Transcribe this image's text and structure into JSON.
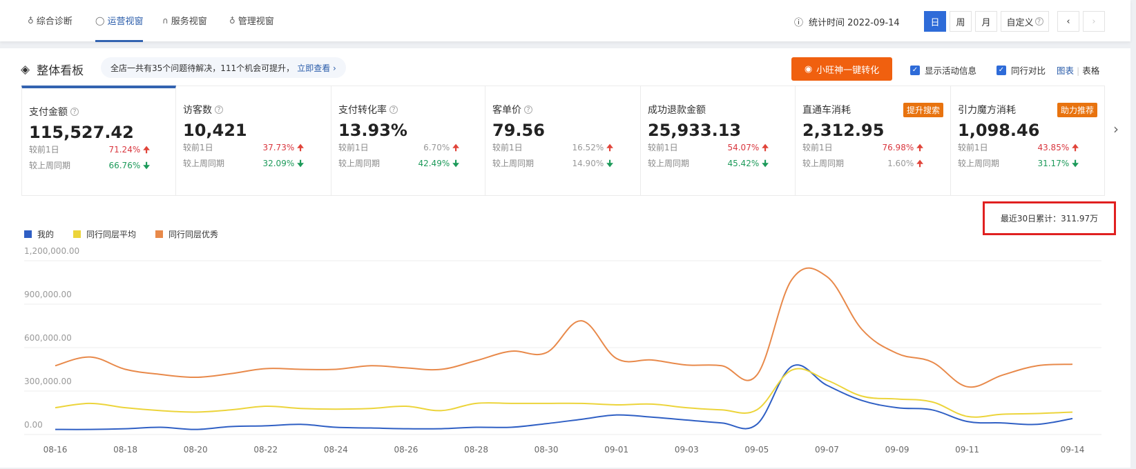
{
  "nav": {
    "tabs": [
      {
        "label": "综合诊断",
        "icon": "bulb-icon"
      },
      {
        "label": "运营视窗",
        "icon": "shield-icon",
        "active": true
      },
      {
        "label": "服务视窗",
        "icon": "headset-icon"
      },
      {
        "label": "管理视窗",
        "icon": "medal-icon"
      }
    ],
    "stat_label": "统计时间 2022-09-14",
    "periods": [
      "日",
      "周",
      "月",
      "自定义"
    ],
    "active_period": "日"
  },
  "board": {
    "title": "整体看板",
    "notice": "全店一共有35个问题待解决，111个机会可提升，",
    "notice_link": "立即查看 ›",
    "convert_button": "小旺神一键转化",
    "show_activity": "显示活动信息",
    "peer_compare": "同行对比",
    "view_chart": "图表",
    "view_table": "表格"
  },
  "cards": [
    {
      "title": "支付金额",
      "value": "115,527.42",
      "d1": "71.24%",
      "d1dir": "up",
      "w1": "66.76%",
      "w1dir": "down",
      "help": true
    },
    {
      "title": "访客数",
      "value": "10,421",
      "d1": "37.73%",
      "d1dir": "up",
      "w1": "32.09%",
      "w1dir": "down",
      "help": true
    },
    {
      "title": "支付转化率",
      "value": "13.93%",
      "d1": "6.70%",
      "d1dir": "up",
      "w1": "42.49%",
      "w1dir": "down",
      "help": true
    },
    {
      "title": "客单价",
      "value": "79.56",
      "d1": "16.52%",
      "d1dir": "up",
      "w1": "14.90%",
      "w1dir": "down",
      "help": true
    },
    {
      "title": "成功退款金额",
      "value": "25,933.13",
      "d1": "54.07%",
      "d1dir": "up",
      "w1": "45.42%",
      "w1dir": "down"
    },
    {
      "title": "直通车消耗",
      "value": "2,312.95",
      "d1": "76.98%",
      "d1dir": "up",
      "w1": "1.60%",
      "w1dir": "up",
      "tag": "提升搜索"
    },
    {
      "title": "引力魔方消耗",
      "value": "1,098.46",
      "d1": "43.85%",
      "d1dir": "up",
      "w1": "31.17%",
      "w1dir": "down",
      "tag": "助力推荐"
    }
  ],
  "labels": {
    "d1": "较前1日",
    "w1": "较上周同期"
  },
  "total": "最近30日累计：311.97万",
  "chart_data": {
    "type": "line",
    "ylim": [
      0,
      1200000
    ],
    "yticks": [
      "0.00",
      "300,000.00",
      "600,000.00",
      "900,000.00",
      "1,200,000.00"
    ],
    "grid": true,
    "legend": "top-left",
    "x": [
      "08-16",
      "08-17",
      "08-18",
      "08-19",
      "08-20",
      "08-21",
      "08-22",
      "08-23",
      "08-24",
      "08-25",
      "08-26",
      "08-27",
      "08-28",
      "08-29",
      "08-30",
      "08-31",
      "09-01",
      "09-02",
      "09-03",
      "09-04",
      "09-05",
      "09-06",
      "09-07",
      "09-08",
      "09-09",
      "09-10",
      "09-11",
      "09-12",
      "09-13",
      "09-14"
    ],
    "xticks": [
      "08-16",
      "08-18",
      "08-20",
      "08-22",
      "08-24",
      "08-26",
      "08-28",
      "08-30",
      "09-01",
      "09-03",
      "09-05",
      "09-07",
      "09-09",
      "09-11",
      "09-14"
    ],
    "series": [
      {
        "name": "我的",
        "color": "#2f5fc4",
        "values": [
          35000,
          35000,
          40000,
          50000,
          35000,
          55000,
          60000,
          70000,
          50000,
          45000,
          40000,
          40000,
          50000,
          50000,
          75000,
          105000,
          135000,
          120000,
          100000,
          80000,
          70000,
          470000,
          340000,
          235000,
          185000,
          170000,
          90000,
          80000,
          70000,
          110000
        ]
      },
      {
        "name": "同行同层平均",
        "color": "#ecd43a",
        "values": [
          185000,
          215000,
          185000,
          165000,
          155000,
          170000,
          195000,
          180000,
          175000,
          180000,
          195000,
          165000,
          215000,
          215000,
          215000,
          215000,
          205000,
          210000,
          185000,
          170000,
          170000,
          445000,
          375000,
          265000,
          245000,
          225000,
          125000,
          140000,
          145000,
          155000
        ]
      },
      {
        "name": "同行同层优秀",
        "color": "#e8894a",
        "values": [
          475000,
          535000,
          450000,
          415000,
          395000,
          420000,
          455000,
          450000,
          450000,
          475000,
          460000,
          450000,
          510000,
          575000,
          565000,
          785000,
          525000,
          515000,
          480000,
          475000,
          410000,
          1070000,
          1090000,
          725000,
          560000,
          500000,
          330000,
          410000,
          475000,
          485000
        ]
      }
    ]
  }
}
